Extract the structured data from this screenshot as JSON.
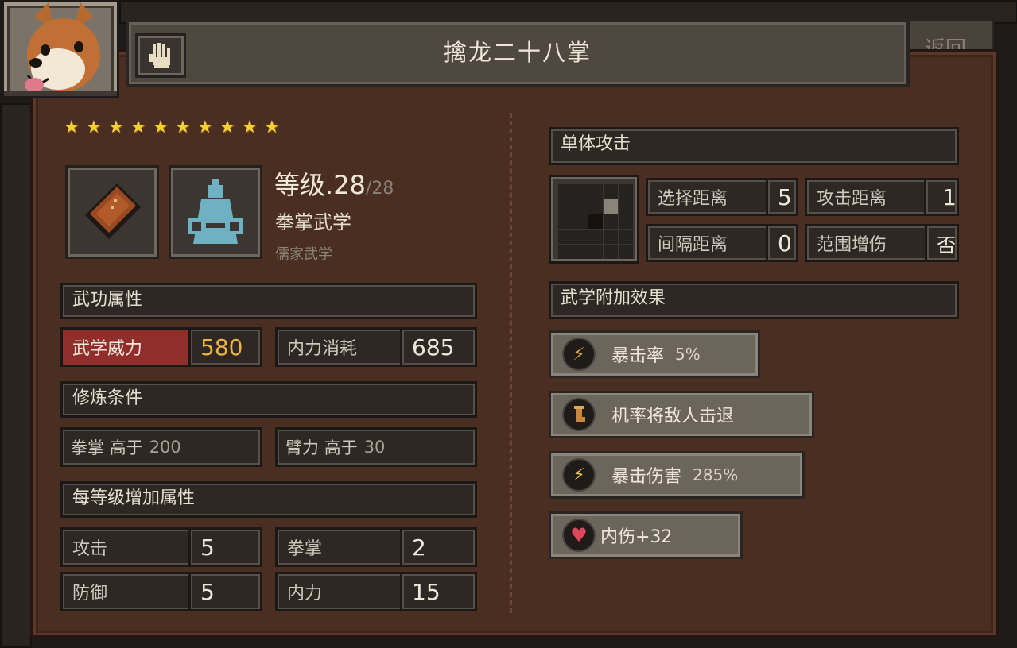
{
  "skill": {
    "title": "擒龙二十八掌",
    "stars": 10,
    "level_label": "等级",
    "level": ".28",
    "level_max": "/28",
    "type": "拳掌武学",
    "school": "儒家武学"
  },
  "header": {
    "back_label": "返回"
  },
  "attributes": {
    "header": "武功属性",
    "power_label": "武学威力",
    "power_value": "580",
    "cost_label": "内力消耗",
    "cost_value": "685"
  },
  "requirements": {
    "header": "修炼条件",
    "items": [
      {
        "label": "拳掌",
        "cond": "高于",
        "value": "200"
      },
      {
        "label": "臂力",
        "cond": "高于",
        "value": "30"
      }
    ]
  },
  "per_level": {
    "header": "每等级增加属性",
    "items": [
      {
        "label": "攻击",
        "value": "5"
      },
      {
        "label": "拳掌",
        "value": "2"
      },
      {
        "label": "防御",
        "value": "5"
      },
      {
        "label": "内力",
        "value": "15"
      }
    ]
  },
  "attack": {
    "header": "单体攻击",
    "select_range_label": "选择距离",
    "select_range_value": "5",
    "attack_range_label": "攻击距离",
    "attack_range_value": "1",
    "interval_label": "间隔距离",
    "interval_value": "0",
    "aoe_label": "范围增伤",
    "aoe_value": "否"
  },
  "effects": {
    "header": "武学附加效果",
    "items": [
      {
        "text": "暴击率",
        "value": "5%",
        "icon": "lightning-icon",
        "color": "#f0b341"
      },
      {
        "text": "机率将敌人击退",
        "value": "",
        "icon": "boot-icon",
        "color": "#c8873a"
      },
      {
        "text": "暴击伤害",
        "value": "285%",
        "icon": "lightning-icon",
        "color": "#f0c851"
      },
      {
        "text": "内伤+32",
        "value": "",
        "icon": "broken-heart-icon",
        "color": "#e0475a"
      }
    ]
  },
  "colors": {
    "panel": "#4a2e22",
    "power_highlight": "#8f2e2b",
    "gold": "#f0b341"
  }
}
